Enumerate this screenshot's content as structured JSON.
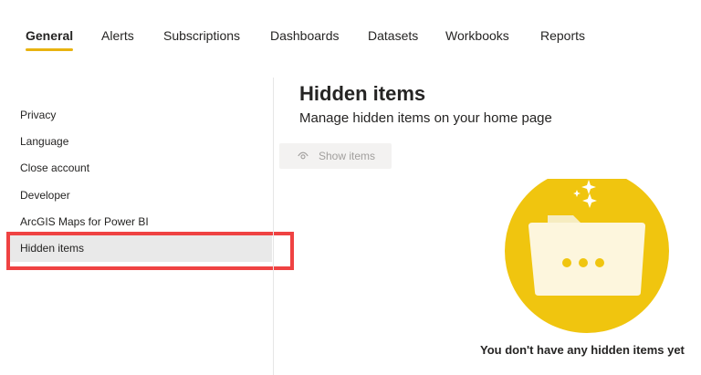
{
  "tabs": [
    {
      "label": "General",
      "active": true
    },
    {
      "label": "Alerts",
      "active": false
    },
    {
      "label": "Subscriptions",
      "active": false
    },
    {
      "label": "Dashboards",
      "active": false
    },
    {
      "label": "Datasets",
      "active": false
    },
    {
      "label": "Workbooks",
      "active": false
    },
    {
      "label": "Reports",
      "active": false
    }
  ],
  "sidebar": {
    "items": [
      {
        "label": "Privacy"
      },
      {
        "label": "Language"
      },
      {
        "label": "Close account"
      },
      {
        "label": "Developer"
      },
      {
        "label": "ArcGIS Maps for Power BI"
      },
      {
        "label": "Hidden items",
        "selected": true
      }
    ]
  },
  "main": {
    "title": "Hidden items",
    "subtitle": "Manage hidden items on your home page",
    "show_button_label": "Show items",
    "show_button_icon": "eye-icon",
    "empty_message": "You don't have any hidden items yet",
    "illustration_icon": "empty-folder-illustration"
  },
  "colors": {
    "accent": "#e8b310",
    "illustration_circle": "#f0c50f",
    "highlight": "#ef4242",
    "selected_bg": "#e9e9e9"
  }
}
